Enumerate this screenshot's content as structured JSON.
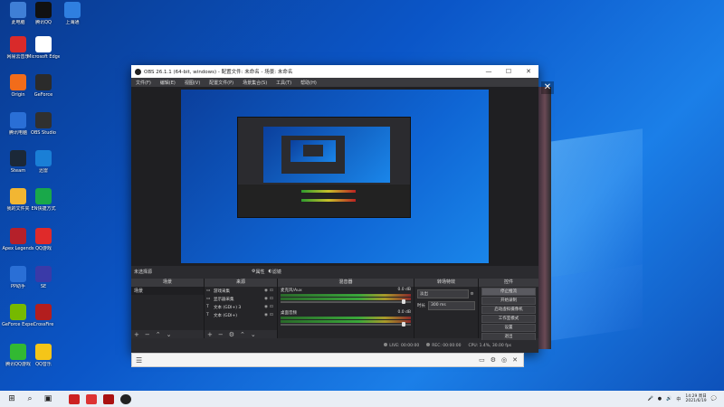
{
  "desktop": {
    "icons": [
      {
        "label": "此电脑",
        "color": "#3f7fd6"
      },
      {
        "label": "腾讯QQ",
        "color": "#111111"
      },
      {
        "label": "上海通",
        "color": "#2f7fe0"
      },
      {
        "label": "网易云音乐",
        "color": "#d92a2a"
      },
      {
        "label": "Microsoft Edge",
        "color": "#ffffff"
      },
      {
        "label": "Origin",
        "color": "#f26c1a"
      },
      {
        "label": "GeForce",
        "color": "#2b2b2b"
      },
      {
        "label": "腾讯电脑",
        "color": "#2a6fd6"
      },
      {
        "label": "OBS Studio",
        "color": "#303030"
      },
      {
        "label": "Steam",
        "color": "#1b2838"
      },
      {
        "label": "迅雷",
        "color": "#1a7fd6"
      },
      {
        "label": "我的文件夹",
        "color": "#f2b632"
      },
      {
        "label": "EN快捷方式",
        "color": "#19a84a"
      },
      {
        "label": "Apex Legends",
        "color": "#b5202a"
      },
      {
        "label": "QQ游戏",
        "color": "#e02a2a"
      },
      {
        "label": "PP助手",
        "color": "#2a6fd6"
      },
      {
        "label": "SE",
        "color": "#3a3aa8"
      },
      {
        "label": "GeForce Experience",
        "color": "#76b900"
      },
      {
        "label": "CrossFire",
        "color": "#b31e1e"
      },
      {
        "label": "腾讯QQ游戏",
        "color": "#32b932"
      },
      {
        "label": "QQ音乐",
        "color": "#f5c518"
      }
    ]
  },
  "obs": {
    "title": "OBS 26.1.1 (64-bit, windows) - 配置文件: 未命名 - 场景: 未命名",
    "menu": [
      "文件(F)",
      "编辑(E)",
      "视图(V)",
      "配置文件(P)",
      "场景集合(S)",
      "工具(T)",
      "帮助(H)"
    ],
    "no_source": "未选择源",
    "properties": "属性",
    "filters": "滤镜",
    "docks": {
      "scenes": "场景",
      "sources": "来源",
      "mixer": "混音器",
      "transitions": "转场特效",
      "controls": "控件"
    },
    "scenes": [
      "场景"
    ],
    "sources": [
      {
        "name": "游戏采集",
        "icon": "game-capture-icon"
      },
      {
        "name": "显示器采集",
        "icon": "display-capture-icon"
      },
      {
        "name": "文本 (GDI+) 3",
        "icon": "text-icon"
      },
      {
        "name": "文本 (GDI+)",
        "icon": "text-icon"
      }
    ],
    "mixer": [
      {
        "name": "桌面音频",
        "value": "0.0 dB"
      },
      {
        "name": "麦克风/Aux",
        "value": "0.0 dB"
      }
    ],
    "transition": {
      "name": "淡出",
      "duration_label": "时长",
      "duration": "300 ms"
    },
    "controls": [
      "停止推流",
      "开始录制",
      "启动虚拟摄像机",
      "工作室模式",
      "设置",
      "退出"
    ],
    "status": {
      "live": "LIVE: 00:00:00",
      "rec": "REC: 00:00:00",
      "cpu": "CPU: 1.4%, 30.00 fps"
    }
  },
  "taskbar": {
    "time": "14:29 周日",
    "date": "2021/6/19",
    "lang": "中"
  }
}
